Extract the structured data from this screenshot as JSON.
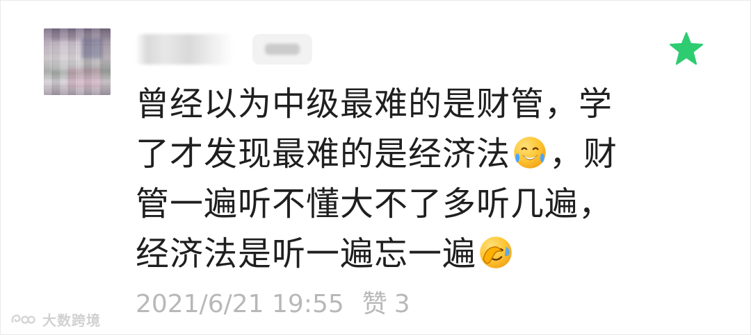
{
  "comment": {
    "line1": "曾经以为中级最难的是财管，学",
    "line2_prefix": "了才发现最难的是经济法",
    "line2_suffix": "，财",
    "line3": "管一遍听不懂大不了多听几遍，",
    "line4_prefix": "经济法是听一遍忘一遍",
    "emoji_1": "laughing-with-tears-emoji",
    "emoji_2": "facepalm-emoji"
  },
  "meta": {
    "timestamp": "2021/6/21 19:55",
    "likes_label": "赞",
    "likes_count": "3"
  },
  "icons": {
    "star": "star-icon",
    "watermark_logo": "watermark-logo-icon"
  },
  "colors": {
    "star_green": "#2ecc71",
    "text_primary": "#1f1f1f",
    "text_meta": "#b8b8b8"
  },
  "watermark": {
    "text": "大数跨境"
  }
}
